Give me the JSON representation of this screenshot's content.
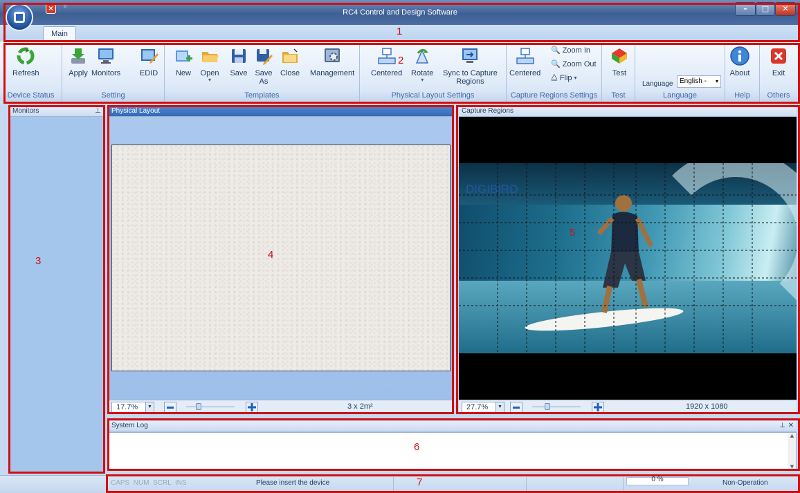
{
  "window": {
    "title": "RC4 Control and Design Software",
    "tab": "Main"
  },
  "ribbon": {
    "groups": [
      {
        "name": "Device Status",
        "buttons": [
          {
            "label": "Refresh",
            "icon": "refresh-recycle-icon"
          }
        ]
      },
      {
        "name": "Setting",
        "buttons": [
          {
            "label": "Apply",
            "icon": "apply-download-icon"
          },
          {
            "label": "Monitors",
            "icon": "monitor-icon"
          },
          {
            "label": "EDID",
            "icon": "edid-edit-icon"
          }
        ]
      },
      {
        "name": "Templates",
        "buttons": [
          {
            "label": "New",
            "icon": "new-template-icon"
          },
          {
            "label": "Open",
            "icon": "open-folder-icon"
          },
          {
            "label": "Save",
            "icon": "save-disk-icon"
          },
          {
            "label": "Save As",
            "icon": "save-as-icon"
          },
          {
            "label": "Close",
            "icon": "close-folder-icon"
          },
          {
            "label": "Management",
            "icon": "management-gear-icon"
          }
        ]
      },
      {
        "name": "Physical Layout Settings",
        "buttons": [
          {
            "label": "Centered",
            "icon": "centered-icon"
          },
          {
            "label": "Rotate",
            "icon": "rotate-icon"
          },
          {
            "label": "Sync to Capture Regions",
            "icon": "sync-icon"
          }
        ]
      },
      {
        "name": "Capture Regions Settings",
        "buttons": [
          {
            "label": "Centered",
            "icon": "centered-icon"
          },
          {
            "label": "Zoom In",
            "icon": "zoom-in-icon"
          },
          {
            "label": "Zoom Out",
            "icon": "zoom-out-icon"
          },
          {
            "label": "Flip",
            "icon": "flip-icon"
          }
        ]
      },
      {
        "name": "Test",
        "buttons": [
          {
            "label": "Test",
            "icon": "test-colors-icon"
          }
        ]
      },
      {
        "name": "Language",
        "label": "Language",
        "selected": "English -"
      },
      {
        "name": "Help",
        "buttons": [
          {
            "label": "About",
            "icon": "info-icon"
          }
        ]
      },
      {
        "name": "Others",
        "buttons": [
          {
            "label": "Exit",
            "icon": "exit-x-icon"
          }
        ]
      }
    ],
    "sync_line1": "Sync to Capture",
    "sync_line2": "Regions",
    "saveas_line1": "Save",
    "saveas_line2": "As"
  },
  "panels": {
    "monitors": {
      "title": "Monitors"
    },
    "physical_layout": {
      "title": "Physical Layout",
      "zoom": "17.7%",
      "info": "3 x 2m²"
    },
    "capture_regions": {
      "title": "Capture Regions",
      "zoom": "27.7%",
      "info": "1920 x 1080",
      "logo": "DIGIBIRD"
    },
    "system_log": {
      "title": "System Log"
    }
  },
  "statusbar": {
    "indicators": "CAPS  NUM  SCRL  INS",
    "message": "Please insert the device",
    "progress": "0 %",
    "progress_value": 0,
    "mode": "Non-Operation"
  },
  "callouts": [
    "1",
    "2",
    "3",
    "4",
    "5",
    "6",
    "7"
  ],
  "colors": {
    "callout": "#d01010",
    "accent": "#3468b6"
  }
}
